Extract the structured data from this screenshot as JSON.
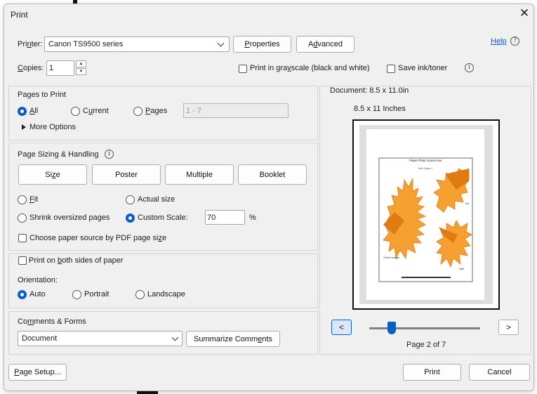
{
  "window": {
    "title": "Print"
  },
  "header": {
    "printer_label": "Printer:",
    "printer_value": "Canon TS9500 series",
    "properties_label": "Properties",
    "advanced_label": "Advanced",
    "help_label": "Help",
    "copies_label": "Copies:",
    "copies_value": "1",
    "grayscale_label": "Print in grayscale (black and white)",
    "save_ink_label": "Save ink/toner"
  },
  "pages_to_print": {
    "title": "Pages to Print",
    "all_label": "All",
    "current_label": "Current",
    "pages_label": "Pages",
    "pages_placeholder": "1 - 7",
    "more_options_label": "More Options",
    "selected": "All"
  },
  "sizing": {
    "title": "Page Sizing & Handling",
    "tabs": [
      "Size",
      "Poster",
      "Multiple",
      "Booklet"
    ],
    "fit_label": "Fit",
    "actual_size_label": "Actual size",
    "shrink_label": "Shrink oversized pages",
    "custom_scale_label": "Custom Scale:",
    "custom_scale_value": "70",
    "percent_sign": "%",
    "paper_source_label": "Choose paper source by PDF page size",
    "selected": "Custom Scale"
  },
  "duplex": {
    "both_sides_label": "Print on both sides of paper",
    "orientation_label": "Orientation:",
    "auto_label": "Auto",
    "portrait_label": "Portrait",
    "landscape_label": "Landscape",
    "selected": "Auto"
  },
  "comments": {
    "title": "Comments & Forms",
    "value": "Document",
    "summarize_label": "Summarize Comments"
  },
  "preview": {
    "document_size": "Document: 8.5 x 11.0in",
    "paper_size": "8.5 x 11 Inches",
    "thumbnail": {
      "title": "Paper Plate Scarecrow",
      "subtitle": "Hair Option 1",
      "label_left": "left",
      "label_right": "right",
      "label_center": "Center triangle"
    },
    "page_status": "Page 2 of 7",
    "prev_label": "<",
    "next_label": ">",
    "page_position_fraction": 0.17
  },
  "footer": {
    "page_setup_label": "Page Setup...",
    "print_label": "Print",
    "cancel_label": "Cancel"
  },
  "colors": {
    "accent": "#0a5fc4",
    "hair_orange": "#f5a031",
    "hair_dark": "#e07b12"
  }
}
